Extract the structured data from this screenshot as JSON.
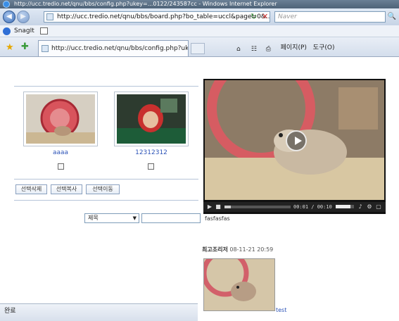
{
  "window": {
    "title": "http://ucc.tredio.net/qnu/bbs/config.php?ukey=...0122/243587cc - Windows Internet Explorer"
  },
  "addressbar": {
    "url": "http://ucc.tredio.net/qnu/bbs/board.php?bo_table=uccl&page=0&...",
    "search_placeholder": "Naver"
  },
  "snagit": {
    "label": "SnagIt"
  },
  "tab": {
    "title": "http://ucc.tredio.net/qnu/bbs/config.php?ukey"
  },
  "toolbar": {
    "page_label": "페이지(P)",
    "tools_label": "도구(O)"
  },
  "gallery": {
    "items": [
      {
        "caption": "aaaa",
        "thumb_icon": "hamster-wheel-image"
      },
      {
        "caption": "12312312",
        "thumb_icon": "red-hoodie-person-image"
      }
    ]
  },
  "actions": {
    "delete_selected": "선택삭제",
    "copy_selected": "선택복사",
    "move_selected": "선택이동"
  },
  "search": {
    "field_selected": "제목",
    "value": ""
  },
  "player": {
    "timecode": "00:01 / 00:10",
    "progress": 0.1,
    "volume": 0.8,
    "caption": "fasfasfas"
  },
  "recent": {
    "label": "최고조리저",
    "timestamp": "08-11-21 20:59",
    "link": "test"
  },
  "status": {
    "text": "완료"
  }
}
